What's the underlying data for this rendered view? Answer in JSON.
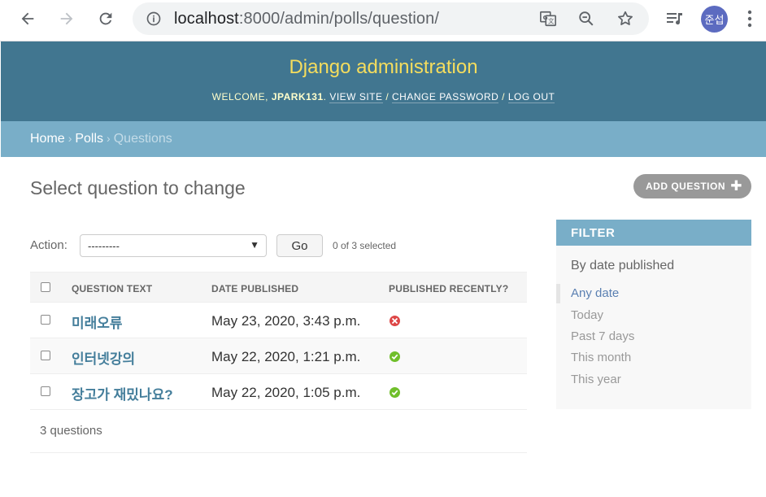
{
  "browser": {
    "url_host": "localhost",
    "url_path": ":8000/admin/polls/question/",
    "profile_initials": "준섭"
  },
  "header": {
    "branding": "Django administration",
    "welcome": "Welcome, ",
    "username": "jpark131",
    "view_site": "View site",
    "change_password": "Change password",
    "log_out": "Log out"
  },
  "breadcrumbs": {
    "home": "Home",
    "app": "Polls",
    "current": "Questions",
    "separator": "›"
  },
  "content": {
    "title": "Select question to change",
    "add_button": "Add question",
    "action_label": "Action:",
    "action_selected": "---------",
    "go_button": "Go",
    "selection_counter": "0 of 3 selected",
    "columns": [
      "Question text",
      "Date published",
      "Published recently?"
    ],
    "rows": [
      {
        "question_text": "미래오류",
        "date_published": "May 23, 2020, 3:43 p.m.",
        "published_recently": false
      },
      {
        "question_text": "인터넷강의",
        "date_published": "May 22, 2020, 1:21 p.m.",
        "published_recently": true
      },
      {
        "question_text": "장고가 재밌나요?",
        "date_published": "May 22, 2020, 1:05 p.m.",
        "published_recently": true
      }
    ],
    "paginator": "3 questions"
  },
  "filter": {
    "title": "Filter",
    "subtitle": "By date published",
    "options": [
      "Any date",
      "Today",
      "Past 7 days",
      "This month",
      "This year"
    ],
    "selected": "Any date"
  },
  "colors": {
    "header_bg": "#417690",
    "branding": "#f5dd5d",
    "breadcrumb_bg": "#79aec8",
    "link": "#447e9b",
    "false_icon": "#dd4646",
    "true_icon": "#70bf2b"
  }
}
